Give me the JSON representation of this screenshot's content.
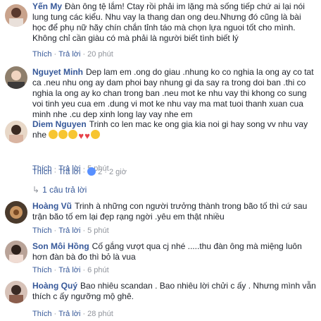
{
  "comments": [
    {
      "author": "Yến My",
      "text": "Đàn ông tệ lắm! Ctay rồi phải im lặng mà sống tiếp chứ ai lại nói lung tung các kiểu. Nhu vay la thang dan ong deu.Nhưng đó cũng là bài học để phụ nữ hãy chín chắn tỉnh táo mà chọn lựa nguoi tốt cho mình. Không chỉ cần giàu có mà phải là người biết tình biết lý",
      "like": "Thích",
      "reply": "Trả lời",
      "time": "20 phút"
    },
    {
      "author": "Nguyet Minh",
      "text": "Dep lam em .ong do giau .nhung ko co nghia la ong ay co tat ca .neu nhu ong ay dam phoi bay nhung gi da say ra trong doi ban .thi co nghia la ong ay ko chan trong ban .neu mot ke nhu vay thi khong co sung voi tinh yeu cua em .dung vi mot ke nhu vay ma mat tuoi thanh xuan cua minh nhe .cu dep xinh long lay vay nhe em",
      "like": "Thích",
      "reply": "Trả lời",
      "time": "5 phút"
    },
    {
      "author": "Diem Nguyen",
      "text": "Trinh co len mac ke ong gia kia noi gi hay song vv nhu vay nhe",
      "like": "Thích",
      "reply": "Trả lời",
      "reactions_count": "2",
      "time": "2 giờ",
      "replies_link": "1 câu trả lời"
    },
    {
      "author": "Hoàng Vũ",
      "text": "Trinh à những con người trưởng thành trong bão tố thì cứ sau trận bão tố em lại đẹp rạng ngời .yêu em thật nhiều",
      "like": "Thích",
      "reply": "Trả lời",
      "time": "5 phút"
    },
    {
      "author": "Son Môi Hồng",
      "text": "Cố gắng vượt qua cj nhé .....thu đàn ông mà miệng luôn hơn đàn bà đo thì bỏ là vua",
      "like": "Thích",
      "reply": "Trả lời",
      "time": "6 phút"
    },
    {
      "author": "Hoàng Quý",
      "text": "Bao nhiêu scandan . Bao nhiêu lời chửi c ấy . Nhưng mình vẫn thích c ấy ngưỡng mộ ghê.",
      "like": "Thích",
      "reply": "Trả lời",
      "time": "28 phút"
    }
  ],
  "colors": {
    "link": "#365899",
    "meta": "#90949c",
    "text": "#1d2129"
  }
}
